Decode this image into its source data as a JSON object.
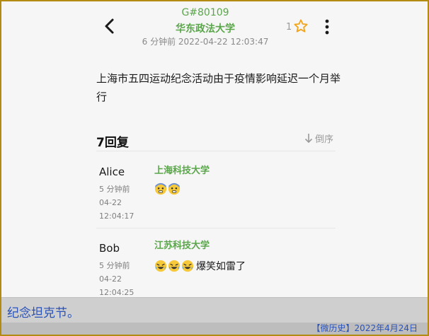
{
  "header": {
    "post_id": "G#80109",
    "school": "华东政法大学",
    "time": "6 分钟前 2022-04-22 12:03:47",
    "star_count": "1"
  },
  "post": {
    "content": "上海市五四运动纪念活动由于疫情影响延迟一个月举行"
  },
  "replies_header": {
    "count_label": "7回复",
    "sort_label": "倒序"
  },
  "replies": [
    {
      "user": "Alice",
      "ago": "5 分钟前",
      "date": "04-22",
      "time": "12:04:17",
      "school": "上海科技大学",
      "text": "",
      "emoji": [
        "fearful-face",
        "fearful-face"
      ]
    },
    {
      "user": "Bob",
      "ago": "5 分钟前",
      "date": "04-22",
      "time": "12:04:25",
      "school": "江苏科技大学",
      "text": "爆笑如雷了",
      "emoji": [
        "rolling-laughing-face",
        "rolling-laughing-face",
        "rolling-laughing-face"
      ]
    }
  ],
  "caption": {
    "text": "纪念坦克节。",
    "footer": "【微历史】2022年4月24日"
  },
  "colors": {
    "accent_green": "#5aa64a",
    "caption_blue": "#2a52b8",
    "star_orange": "#f2a51a",
    "border_gold": "#b38a12"
  }
}
